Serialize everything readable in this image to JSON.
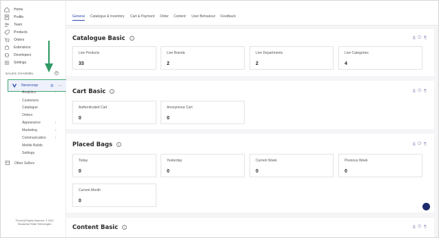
{
  "sidebar": {
    "items": [
      {
        "label": "Home",
        "icon": "home-icon"
      },
      {
        "label": "Profile",
        "icon": "profile-icon"
      },
      {
        "label": "Team",
        "icon": "team-icon"
      },
      {
        "label": "Products",
        "icon": "tag-icon"
      },
      {
        "label": "Orders",
        "icon": "cart-icon"
      },
      {
        "label": "Extensions",
        "icon": "puzzle-icon"
      },
      {
        "label": "Developers",
        "icon": "code-icon"
      },
      {
        "label": "Settings",
        "icon": "gear-icon"
      }
    ],
    "section_label": "SALES CHANNEL",
    "channel": {
      "label": "Nevercoop",
      "status_icon": "gear-icon"
    },
    "sub_items": [
      {
        "label": "Analytics",
        "has_chevron": true
      },
      {
        "label": "Customers",
        "has_chevron": false
      },
      {
        "label": "Catalogue",
        "has_chevron": false
      },
      {
        "label": "Orders",
        "has_chevron": false
      },
      {
        "label": "Appearance",
        "has_chevron": true
      },
      {
        "label": "Marketing",
        "has_chevron": true
      },
      {
        "label": "Communication",
        "has_chevron": true
      },
      {
        "label": "Mobile Builds",
        "has_chevron": false
      },
      {
        "label": "Settings",
        "has_chevron": false
      }
    ],
    "other_sellers": "Other Sellers",
    "footer_line1": "©Fynd All Rights Reserved. © 2022",
    "footer_line2": "Shopsense Retail Technologies"
  },
  "tabs": [
    {
      "label": "General",
      "active": true
    },
    {
      "label": "Catalogue & Inventory",
      "active": false
    },
    {
      "label": "Cart & Payment",
      "active": false
    },
    {
      "label": "Order",
      "active": false
    },
    {
      "label": "Content",
      "active": false
    },
    {
      "label": "User Behaviour",
      "active": false
    },
    {
      "label": "Feedback",
      "active": false
    }
  ],
  "panels": {
    "catalogue": {
      "title": "Catalogue Basic",
      "cards": [
        {
          "label": "Live Products",
          "value": "33"
        },
        {
          "label": "Live Brands",
          "value": "2"
        },
        {
          "label": "Live Departments",
          "value": "2"
        },
        {
          "label": "Live Categories",
          "value": "4"
        }
      ]
    },
    "cart": {
      "title": "Cart Basic",
      "cards": [
        {
          "label": "Authenticated Cart",
          "value": "0"
        },
        {
          "label": "Anonymous Cart",
          "value": "0"
        }
      ]
    },
    "bags": {
      "title": "Placed Bags",
      "cards": [
        {
          "label": "Today",
          "value": "0"
        },
        {
          "label": "Yesterday",
          "value": "0"
        },
        {
          "label": "Current Week",
          "value": "0"
        },
        {
          "label": "Previous Week",
          "value": "0"
        },
        {
          "label": "Current Month",
          "value": "0"
        }
      ]
    },
    "content": {
      "title": "Content Basic"
    }
  },
  "panel_tools": "⎙ ⟳ ⎘",
  "colors": {
    "accent": "#2c46b1",
    "highlight_border": "#3fa66d",
    "arrow": "#2f9a63"
  }
}
